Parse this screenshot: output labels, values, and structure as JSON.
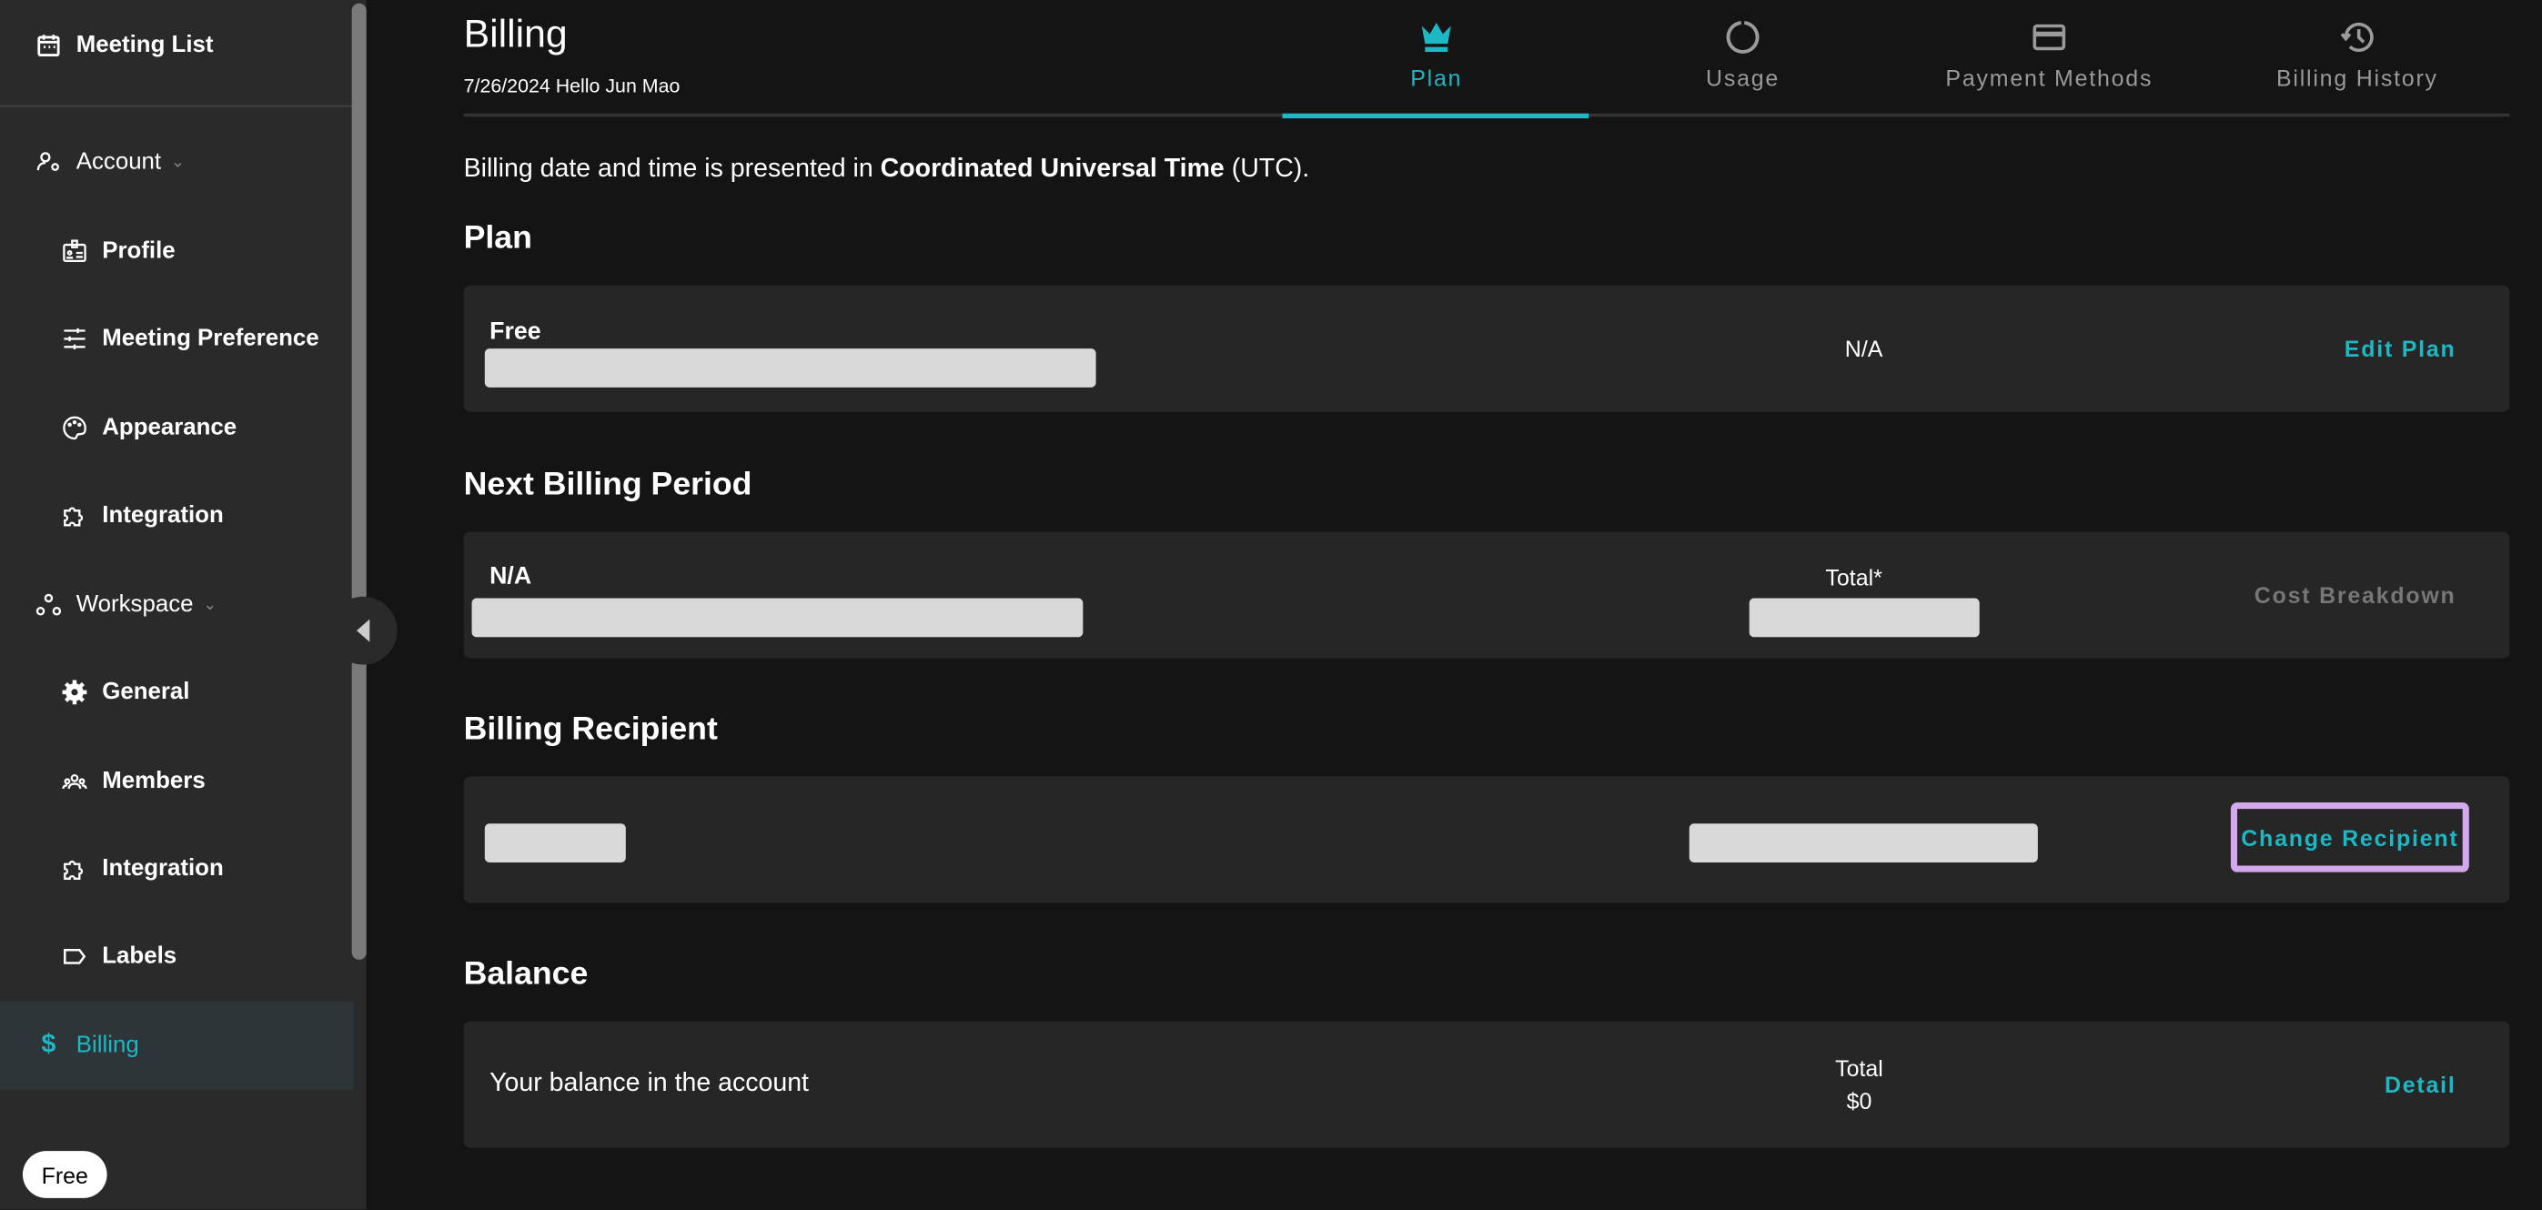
{
  "sidebar": {
    "meeting_list": "Meeting List",
    "account": "Account",
    "profile": "Profile",
    "meeting_preference": "Meeting Preference",
    "appearance": "Appearance",
    "integration_account": "Integration",
    "workspace": "Workspace",
    "general": "General",
    "members": "Members",
    "integration_workspace": "Integration",
    "labels": "Labels",
    "billing": "Billing",
    "plan_badge": "Free"
  },
  "header": {
    "title": "Billing",
    "subtitle": "7/26/2024 Hello Jun Mao"
  },
  "tabs": [
    {
      "label": "Plan",
      "icon": "crown-icon"
    },
    {
      "label": "Usage",
      "icon": "usage-circle-icon"
    },
    {
      "label": "Payment Methods",
      "icon": "credit-card-icon"
    },
    {
      "label": "Billing History",
      "icon": "history-icon"
    }
  ],
  "info": {
    "prefix": "Billing date and time is presented in ",
    "bold": "Coordinated Universal Time",
    "suffix": " (UTC)."
  },
  "plan": {
    "heading": "Plan",
    "name": "Free",
    "price": "N/A",
    "action": "Edit Plan"
  },
  "next_billing": {
    "heading": "Next Billing Period",
    "period": "N/A",
    "total_label": "Total*",
    "action": "Cost Breakdown"
  },
  "recipient": {
    "heading": "Billing Recipient",
    "action": "Change Recipient"
  },
  "balance": {
    "heading": "Balance",
    "label": "Your balance in the account",
    "total_label": "Total",
    "total_value": "$0",
    "action": "Detail"
  },
  "colors": {
    "accent": "#1cb8c4",
    "highlight": "#d4a8ec"
  }
}
